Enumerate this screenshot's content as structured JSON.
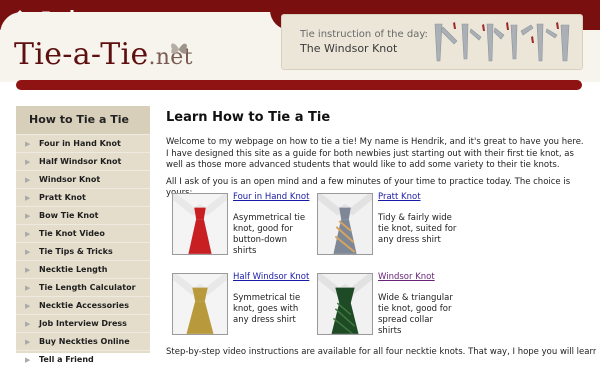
{
  "topbar": {
    "icons": [
      "home-icon",
      "mail-icon",
      "sitemap-icon"
    ]
  },
  "site": {
    "name": "Tie-a-Tie",
    "tld": ".net"
  },
  "tie_of_day": {
    "label": "Tie instruction of the day:",
    "value": "The Windsor Knot"
  },
  "sidebar": {
    "heading": "How to Tie a Tie",
    "items": [
      {
        "label": "Four in Hand Knot"
      },
      {
        "label": "Half Windsor Knot"
      },
      {
        "label": "Windsor Knot"
      },
      {
        "label": "Pratt Knot"
      },
      {
        "label": "Bow Tie Knot"
      },
      {
        "label": "Tie Knot Video"
      },
      {
        "label": "Tie Tips & Tricks"
      },
      {
        "label": "Necktie Length"
      },
      {
        "label": "Tie Length Calculator"
      },
      {
        "label": "Necktie Accessories"
      },
      {
        "label": "Job Interview Dress"
      },
      {
        "label": "Buy Neckties Online"
      },
      {
        "label": "Tell a Friend"
      }
    ]
  },
  "main": {
    "title": "Learn How to Tie a Tie",
    "intro": "Welcome to my webpage on how to tie a tie! My name is Hendrik, and it's great to have you here. I have designed this site as a guide for both newbies just starting out with their first tie knot, as well as those more advanced students that would like to add some variety to their tie knots.",
    "choice": "All I ask of you is an open mind and a few minutes of your time to practice today. The choice is yours:",
    "knots": [
      {
        "name": "Four in Hand Knot",
        "desc": "Asymmetrical tie knot, good for button-down shirts",
        "color": "#c81f23"
      },
      {
        "name": "Pratt Knot",
        "desc": "Tidy & fairly wide tie knot, suited for any dress shirt",
        "color": "#7d8796"
      },
      {
        "name": "Half Windsor Knot",
        "desc": "Symmetrical tie knot, goes with any dress shirt",
        "color": "#b89a3c"
      },
      {
        "name": "Windsor Knot",
        "desc": "Wide & triangular tie knot, good for spread collar shirts",
        "color": "#1f4a26"
      }
    ],
    "footer": "Step-by-step video instructions are available for all four necktie knots. That way, I hope you will learn how to"
  }
}
